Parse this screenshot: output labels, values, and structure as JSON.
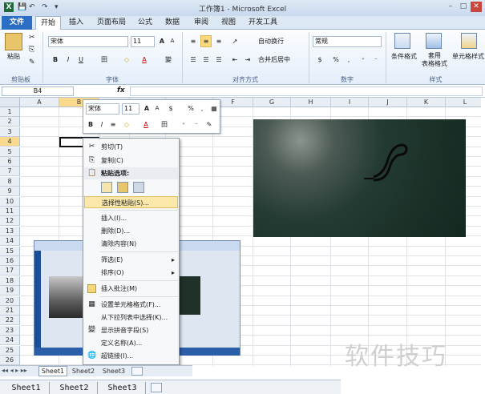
{
  "title": "工作簿1 - Microsoft Excel",
  "window_controls": {
    "minimize": "–",
    "restore": "□",
    "close": "✕"
  },
  "quick_access": {
    "save": "💾",
    "undo": "↶",
    "redo": "↷",
    "customize": "▾"
  },
  "tabs": [
    "文件",
    "开始",
    "插入",
    "页面布局",
    "公式",
    "数据",
    "审阅",
    "视图",
    "开发工具"
  ],
  "ribbon": {
    "clipboard": {
      "paste": "粘贴",
      "group": "剪贴板"
    },
    "font": {
      "name": "宋体",
      "size": "11",
      "bold": "B",
      "italic": "I",
      "underline": "U",
      "grow": "A",
      "shrink": "A",
      "border": "田",
      "fill": "◇",
      "color": "A",
      "phonetic": "變",
      "group": "字体"
    },
    "alignment": {
      "wrap": "自动换行",
      "merge": "合并后居中",
      "group": "对齐方式"
    },
    "number": {
      "format": "常规",
      "percent": "%",
      "comma": ",",
      "group": "数字"
    },
    "styles": {
      "conditional": "条件格式",
      "table": "套用\n表格格式",
      "cell": "单元格样式",
      "group": "样式"
    }
  },
  "formula_bar": {
    "cell_ref": "B4",
    "fx": "fx",
    "value": ""
  },
  "columns": [
    "A",
    "B",
    "C",
    "D",
    "E",
    "F",
    "G",
    "H",
    "I",
    "J",
    "K",
    "L"
  ],
  "rows": [
    "1",
    "2",
    "3",
    "4",
    "5",
    "6",
    "7",
    "8",
    "9",
    "10",
    "11",
    "12",
    "13",
    "14",
    "15",
    "16",
    "17",
    "18",
    "19",
    "20",
    "21",
    "22",
    "23",
    "24",
    "25",
    "26"
  ],
  "mini_toolbar": {
    "font": "宋体",
    "size": "11",
    "grow": "A",
    "shrink": "A",
    "percent": "%",
    "comma": ",",
    "bold": "B",
    "italic": "I"
  },
  "context_menu": {
    "cut": "剪切(T)",
    "copy": "复制(C)",
    "paste_options": "粘贴选项:",
    "paste_special": "选择性粘贴(S)...",
    "insert": "插入(I)...",
    "delete": "删除(D)...",
    "clear": "清除内容(N)",
    "filter": "筛选(E)",
    "sort": "排序(O)",
    "comment": "插入批注(M)",
    "format_cells": "设置单元格格式(F)...",
    "pick_list": "从下拉列表中选择(K)...",
    "phonetic": "显示拼音字段(S)",
    "define_name": "定义名称(A)...",
    "hyperlink": "超链接(I)..."
  },
  "sheet_tabs": [
    "Sheet1",
    "Sheet2",
    "Sheet3"
  ],
  "bottom_tabs": [
    "Sheet1",
    "Sheet2",
    "Sheet3"
  ],
  "watermark": "软件技巧",
  "colors": {
    "accent": "#2a6fc4",
    "ribbon": "#e4eefa",
    "highlight": "#fbd981"
  }
}
